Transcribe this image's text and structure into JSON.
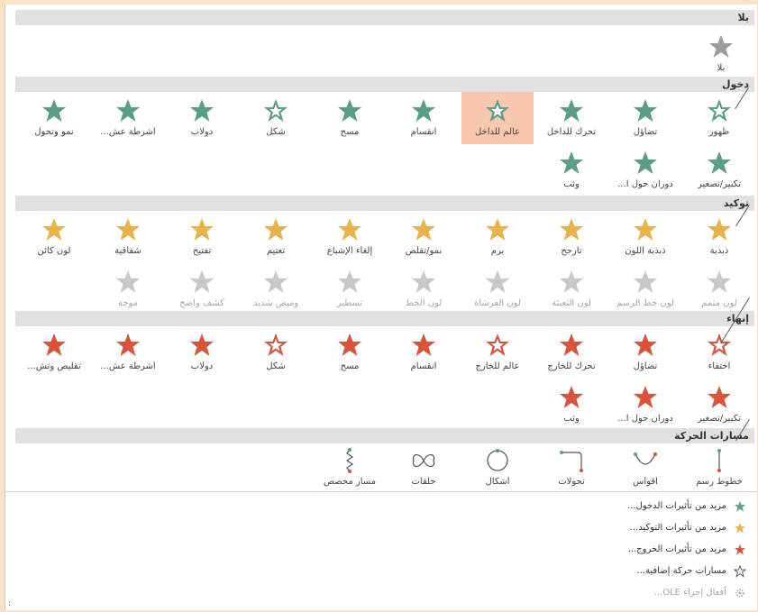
{
  "colors": {
    "entrance": "#5a9e85",
    "emphasis": "#e8b44a",
    "exit": "#d9533d",
    "none": "#9b9b9b",
    "disabled": "#c8c8c8",
    "selected": "#f8c7ad"
  },
  "sections": {
    "none": {
      "title": "بلا",
      "item": "بلا"
    },
    "entrance": {
      "title": "دخول",
      "row1": [
        "ظهور",
        "تضاؤل",
        "تحرك للداخل",
        "عالم للداخل",
        "انقسام",
        "مسح",
        "شكل",
        "دولاب",
        "أشرطة عش...",
        "نمو وتحول"
      ],
      "row2": [
        "تكبير/تصغير",
        "دوران حول ا...",
        "وثب"
      ]
    },
    "emphasis": {
      "title": "توكيد",
      "row1": [
        "ذبذبة",
        "ذبذبة اللون",
        "تأرجح",
        "برم",
        "نمو/تقلص",
        "إلغاء الإشباع",
        "تعتيم",
        "تفتيح",
        "شفافية",
        "لون كائن"
      ],
      "row2": [
        "لون متمم",
        "لون خط الرسم",
        "لون التعبئة",
        "لون الفرشاة",
        "لون الخط",
        "تسطير",
        "وميض شديد",
        "كشف واضح",
        "موجة"
      ]
    },
    "exit": {
      "title": "إنهاء",
      "row1": [
        "اختفاء",
        "تضاؤل",
        "تحرك للخارج",
        "عالم للخارج",
        "انقسام",
        "مسح",
        "شكل",
        "دولاب",
        "أشرطة عش...",
        "تقليص وتش..."
      ],
      "row2": [
        "تكبير/تصغير",
        "دوران حول ا...",
        "وثب"
      ]
    },
    "paths": {
      "title": "مسارات الحركة",
      "items": [
        "خطوط رسم",
        "أقواس",
        "تحولات",
        "أشكال",
        "حلقات",
        "مسار مخصص"
      ]
    }
  },
  "more": [
    "مزيد من تأثيرات الدخول...",
    "مزيد من تأثيرات التوكيد...",
    "مزيد من تأثيرات الخروج...",
    "مسارات حركة إضافية...",
    "أفعال إجراء OLE..."
  ],
  "status": ":"
}
